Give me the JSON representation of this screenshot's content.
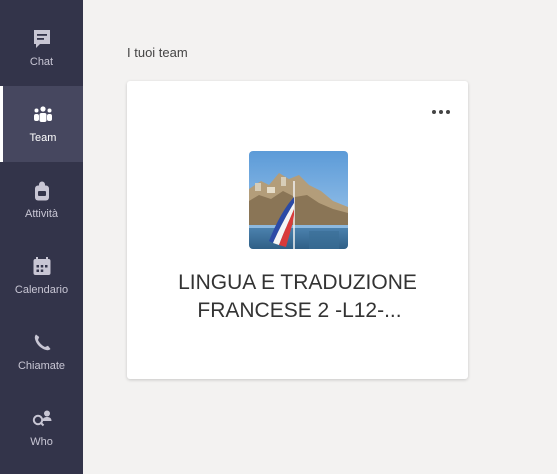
{
  "rail": {
    "items": [
      {
        "label": "Chat",
        "icon": "chat-icon"
      },
      {
        "label": "Team",
        "icon": "teams-icon",
        "active": true
      },
      {
        "label": "Attività",
        "icon": "activity-icon"
      },
      {
        "label": "Calendario",
        "icon": "calendar-icon"
      },
      {
        "label": "Chiamate",
        "icon": "phone-icon"
      },
      {
        "label": "Who",
        "icon": "who-icon"
      }
    ]
  },
  "main": {
    "section_title": "I tuoi team",
    "team": {
      "name_line1": "LINGUA E TRADUZIONE",
      "name_line2": "FRANCESE 2 -L12-...",
      "more_label": "•••"
    }
  },
  "colors": {
    "rail_bg": "#33344a",
    "rail_active_bg": "#46475f",
    "content_bg": "#f3f2f1",
    "card_bg": "#ffffff"
  }
}
